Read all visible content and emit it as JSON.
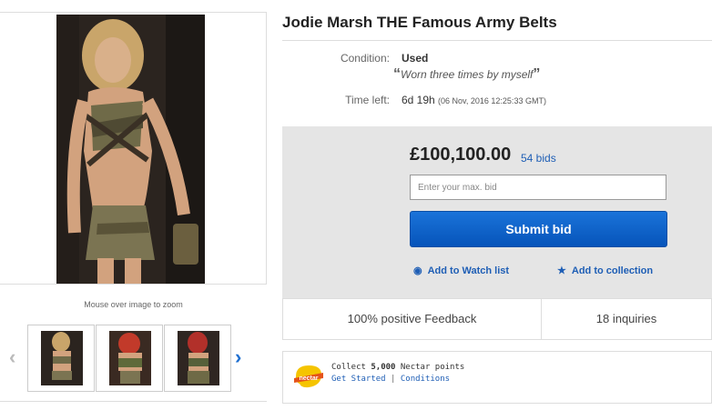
{
  "listing": {
    "title": "Jodie Marsh THE Famous Army Belts",
    "condition_label": "Condition:",
    "condition_value": "Used",
    "condition_note": "Worn three times by myself",
    "time_label": "Time left:",
    "time_value": "6d 19h",
    "time_detail": "(06 Nov, 2016   12:25:33 GMT)"
  },
  "gallery": {
    "zoom_hint": "Mouse over image to zoom",
    "prev_arrow": "‹",
    "next_arrow": "›"
  },
  "bid": {
    "price": "£100,100.00",
    "bids": "54 bids",
    "input_placeholder": "Enter your max. bid",
    "submit_label": "Submit bid",
    "watch_label": "Add to Watch list",
    "collection_label": "Add to collection"
  },
  "seller": {
    "feedback": "100% positive Feedback",
    "inquiries": "18 inquiries"
  },
  "nectar": {
    "logo_text": "nectar",
    "collect_prefix": "Collect ",
    "collect_points": "5,000",
    "collect_suffix": " Nectar points",
    "get_started": "Get Started",
    "separator": "|",
    "conditions": "Conditions"
  },
  "colors": {
    "link": "#1e5eb5",
    "button": "#0654ba",
    "panel": "#e5e5e5"
  }
}
